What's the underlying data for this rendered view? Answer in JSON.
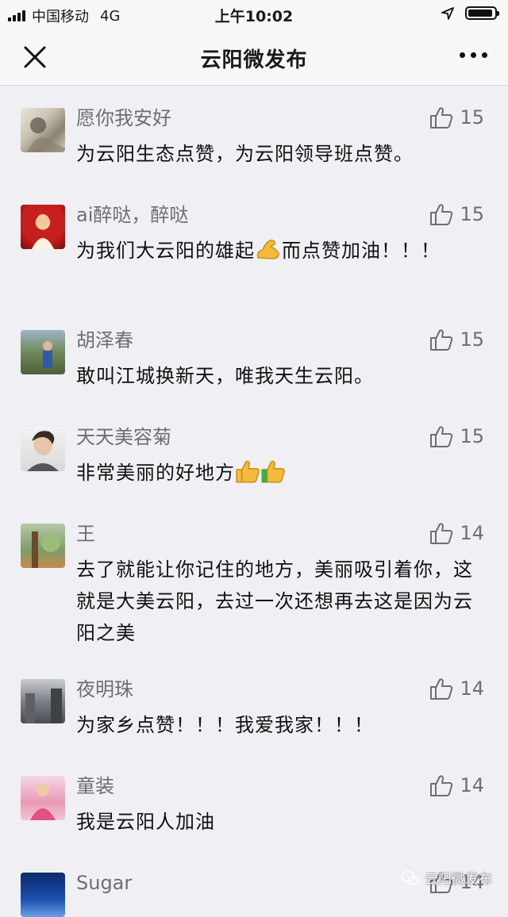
{
  "status_bar": {
    "carrier": "中国移动",
    "network": "4G",
    "time": "上午10:02"
  },
  "nav": {
    "title": "云阳微发布"
  },
  "comments": [
    {
      "name": "愿你我安好",
      "text": "为云阳生态点赞，为云阳领导班点赞。",
      "likes": "15"
    },
    {
      "name": "ai醉哒，醉哒",
      "text_before": "为我们大云阳的雄起",
      "text_after": "而点赞加油！！！",
      "emoji": "flexed-biceps",
      "likes": "15"
    },
    {
      "name": "胡泽春",
      "text": "敢叫江城换新天，唯我天生云阳。",
      "likes": "15"
    },
    {
      "name": "天天美容菊",
      "text": "非常美丽的好地方",
      "emoji": "thumbs-up",
      "likes": "15"
    },
    {
      "name": "王",
      "text": "去了就能让你记住的地方，美丽吸引着你，这就是大美云阳，去过一次还想再去这是因为云阳之美",
      "likes": "14"
    },
    {
      "name": "夜明珠",
      "text": "为家乡点赞！！！我爱我家！！！",
      "likes": "14"
    },
    {
      "name": "童装",
      "text": "我是云阳人加油",
      "likes": "14"
    },
    {
      "name": "Sugar",
      "likes": "14"
    }
  ],
  "watermark": {
    "text": "云阳微发布"
  },
  "colors": {
    "background": "#efeff4",
    "secondary_text": "#6d6d72",
    "primary_text": "#111111"
  }
}
